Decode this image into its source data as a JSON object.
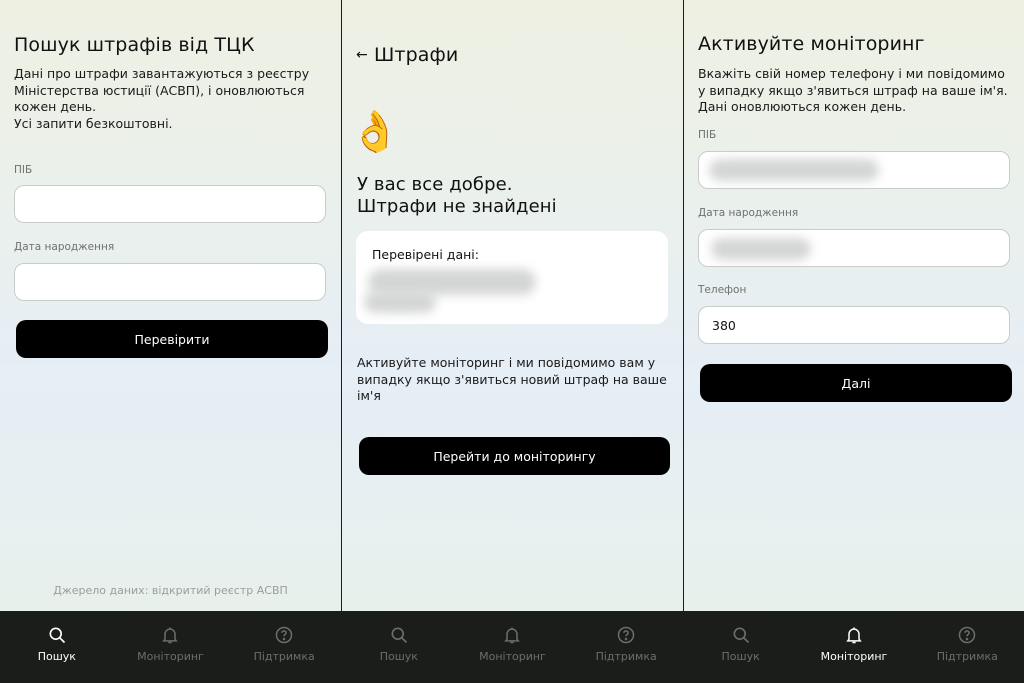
{
  "screen1": {
    "title": "Пошук штрафів від ТЦК",
    "description_line1": "Дані про штрафи завантажуються з реєстру",
    "description_line2": "Міністерства юстиції (АСВП), і оновлюються",
    "description_line3": "кожен день.",
    "description_line4": "Усі запити безкоштовні.",
    "name_label": "ПІБ",
    "name_value": "",
    "dob_label": "Дата народження",
    "dob_value": "",
    "check_button": "Перевірити",
    "source_note": "Джерело даних: відкритий реєстр АСВП"
  },
  "screen2": {
    "title": "Штрафи",
    "back_glyph": "←",
    "emoji": "👌",
    "result_line1": "У вас все добре.",
    "result_line2": "Штрафи не знайдені",
    "card_label": "Перевірені дані:",
    "monitor_line1": "Активуйте моніторинг і ми повідомимо вам у",
    "monitor_line2": "випадку якщо з'явиться новий штраф на ваше",
    "monitor_line3": "ім'я",
    "go_monitoring_button": "Перейти до моніторингу"
  },
  "screen3": {
    "title": "Активуйте моніторинг",
    "description_line1": "Вкажіть свій номер телефону і ми повідомимо",
    "description_line2": "у випадку якщо з'явиться штраф на ваше ім'я.",
    "description_line3": "Дані оновлюються кожен день.",
    "name_label": "ПІБ",
    "dob_label": "Дата народження",
    "phone_label": "Телефон",
    "phone_value": "380",
    "next_button": "Далі"
  },
  "nav": {
    "search_label": "Пошук",
    "monitoring_label": "Моніторинг",
    "support_label": "Підтримка",
    "search_icon": "search-icon",
    "monitoring_icon": "bell-icon",
    "support_icon": "help-circle-icon"
  },
  "colors": {
    "nav_background": "#1b1d1b",
    "nav_active": "#ffffff",
    "nav_inactive": "#6b6e6b",
    "button_background": "#000000",
    "field_border": "#c9ccc9"
  }
}
